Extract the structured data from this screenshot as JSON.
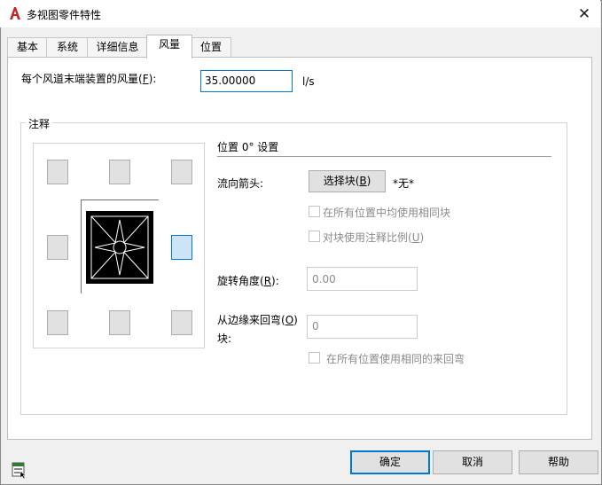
{
  "window": {
    "title": "多视图零件特性",
    "close_symbol": "✕"
  },
  "tabs": [
    {
      "label": "基本",
      "active": false
    },
    {
      "label": "系统",
      "active": false
    },
    {
      "label": "详细信息",
      "active": false
    },
    {
      "label": "风量",
      "active": true
    },
    {
      "label": "位置",
      "active": false
    }
  ],
  "flow": {
    "label_prefix": "每个风道末端装置的风量(",
    "label_key": "F",
    "label_suffix": "):",
    "value": "35.00000",
    "unit": "l/s"
  },
  "annotation": {
    "group_title": "注释",
    "position_header": "位置 0° 设置",
    "selected_position": "middle-right",
    "arrow_label": "流向箭头:",
    "select_block_button": {
      "prefix": "选择块(",
      "key": "B",
      "suffix": ")"
    },
    "block_value": "*无*",
    "use_same_block": {
      "label": "在所有位置中均使用相同块",
      "checked": false,
      "enabled": false
    },
    "block_scale": {
      "prefix": "对块使用注释比例(",
      "key": "U",
      "suffix": ")",
      "checked": false,
      "enabled": false
    },
    "rotation": {
      "prefix": "旋转角度(",
      "key": "R",
      "suffix": "):",
      "value": "0.00"
    },
    "bend": {
      "prefix": "从边缘来回弯(",
      "key": "O",
      "suffix": ")",
      "line2": "块:",
      "value": "0"
    },
    "use_same_bend": {
      "label": "在所有位置使用相同的来回弯",
      "checked": false,
      "enabled": false
    }
  },
  "buttons": {
    "ok": "确定",
    "cancel": "取消",
    "help": "帮助"
  },
  "colors": {
    "accent": "#0078d7",
    "app_icon": "#c4262e",
    "selected_position_fill": "#cce4f7"
  },
  "icons": {
    "app": "autocad-logo-icon",
    "close": "close-icon",
    "help_bottom": "properties-icon"
  }
}
